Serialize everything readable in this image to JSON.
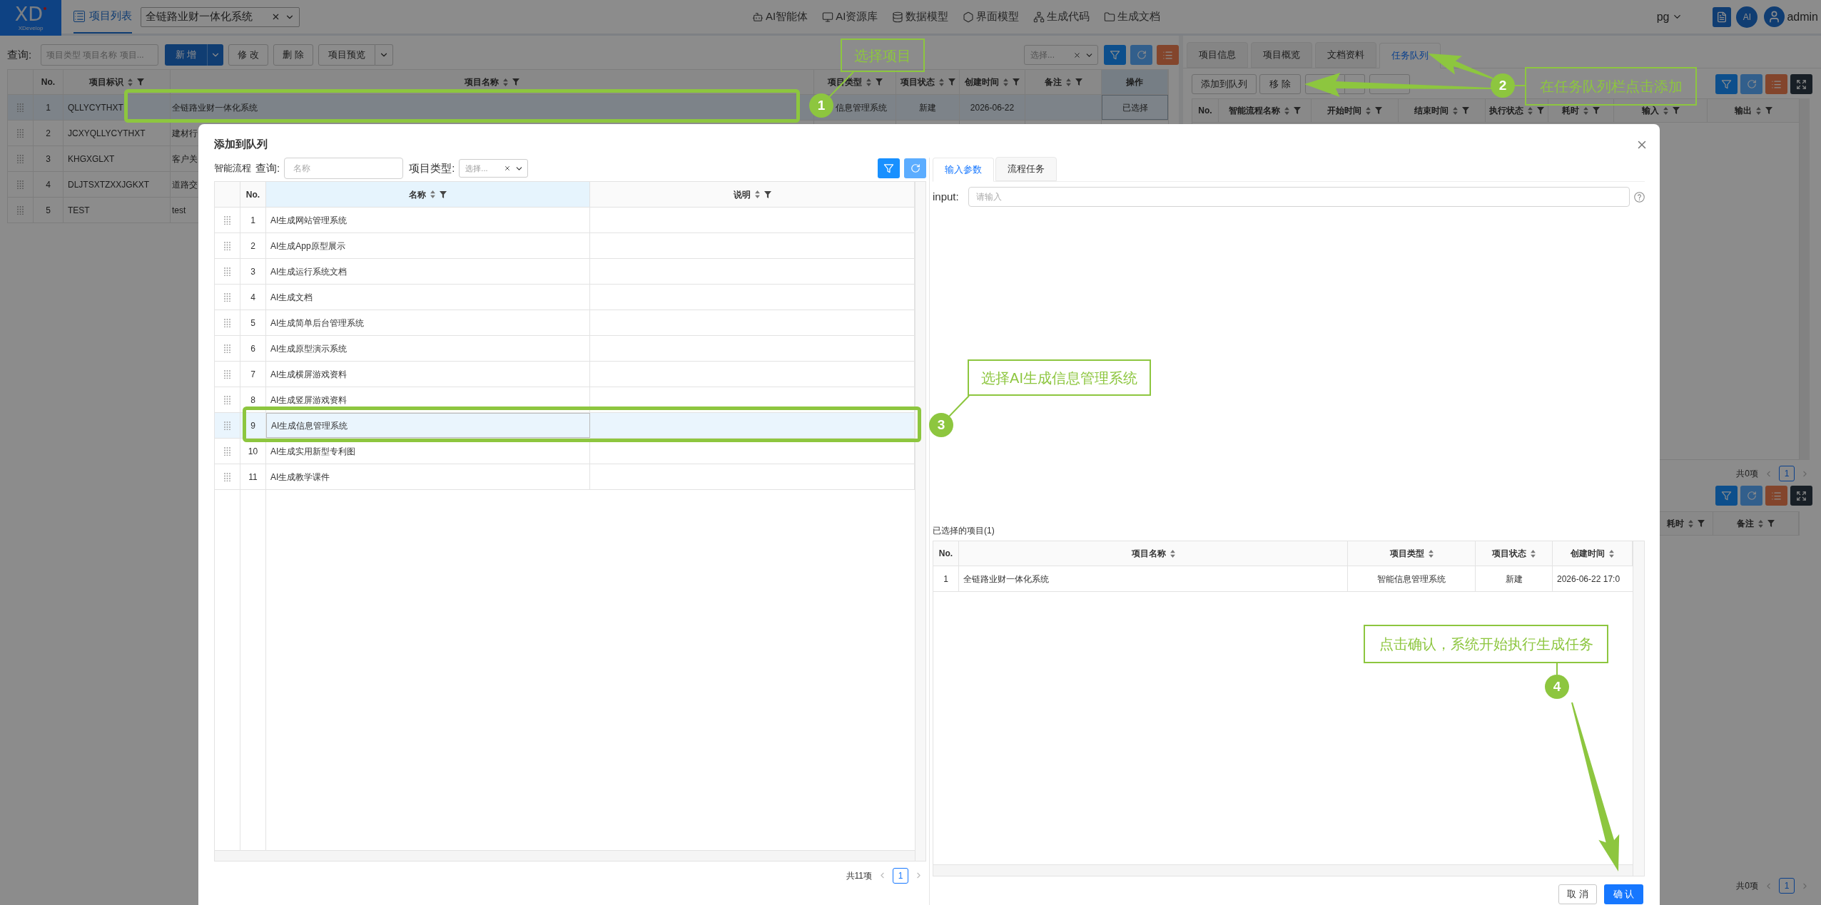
{
  "header": {
    "logo": {
      "mark": "XD",
      "name": "XDevelop"
    },
    "tabs": [
      {
        "label": "项目列表",
        "selected": true
      }
    ],
    "project_select": {
      "value": "全链路业财一体化系统"
    },
    "nav": [
      {
        "label": "AI智能体",
        "kind": "agent"
      },
      {
        "label": "AI资源库",
        "kind": "resources"
      },
      {
        "label": "数据模型",
        "kind": "data"
      },
      {
        "label": "界面模型",
        "kind": "ui"
      },
      {
        "label": "生成代码",
        "kind": "code"
      },
      {
        "label": "生成文档",
        "kind": "docs"
      }
    ],
    "database": "pg",
    "ai_button": "AI",
    "user": "admin"
  },
  "project_list": {
    "query_label": "查询:",
    "search": {
      "placeholder": "项目类型 项目名称 项目..."
    },
    "buttons": [
      {
        "label": "新 增",
        "kind": "primary-split"
      },
      {
        "label": "修 改",
        "kind": "default"
      },
      {
        "label": "删 除",
        "kind": "default"
      },
      {
        "label": "项目预览",
        "kind": "split"
      }
    ],
    "filter_select": {
      "placeholder": "选择..."
    },
    "table": {
      "columns": [
        {
          "label": "No.",
          "kind": "plain"
        },
        {
          "label": "项目标识",
          "kind": "sort-filter"
        },
        {
          "label": "项目名称",
          "kind": "sort-filter"
        },
        {
          "label": "项目类型",
          "kind": "sort-filter"
        },
        {
          "label": "项目状态",
          "kind": "sort-filter"
        },
        {
          "label": "创建时间",
          "kind": "sort-filter"
        },
        {
          "label": "备注",
          "kind": "sort-filter"
        },
        {
          "label": "操作",
          "kind": "action"
        }
      ],
      "rows": [
        {
          "no": "1",
          "code": "QLLYCYTHXT",
          "name": "全链路业财一体化系统",
          "type": "信息管理系统",
          "status": "新建",
          "created": "2026-06-22",
          "action": "已选择",
          "selected": true
        },
        {
          "no": "2",
          "code": "JCXYQLLYCYTHXT",
          "name": "建材行",
          "selected": false
        },
        {
          "no": "3",
          "code": "KHGXGLXT",
          "name": "客户关",
          "selected": false
        },
        {
          "no": "4",
          "code": "DLJTSXTZXXJGKXT",
          "name": "道路交",
          "selected": false
        },
        {
          "no": "5",
          "code": "TEST",
          "name": "test",
          "selected": false
        }
      ]
    }
  },
  "task_panel": {
    "tabs": [
      {
        "label": "项目信息",
        "selected": false
      },
      {
        "label": "项目概览",
        "selected": false
      },
      {
        "label": "文档资料",
        "selected": false
      },
      {
        "label": "任务队列",
        "selected": true
      }
    ],
    "buttons": [
      {
        "label": "添加到队列"
      },
      {
        "label": "移 除"
      }
    ],
    "table": {
      "columns": [
        {
          "label": "No.",
          "kind": "plain"
        },
        {
          "label": "智能流程名称",
          "kind": "sort-filter"
        },
        {
          "label": "开始时间",
          "kind": "sort-filter"
        },
        {
          "label": "结束时间",
          "kind": "sort-filter"
        },
        {
          "label": "执行状态",
          "kind": "sort-filter"
        },
        {
          "label": "耗时",
          "kind": "sort-filter"
        },
        {
          "label": "输入",
          "kind": "sort-filter"
        },
        {
          "label": "输出",
          "kind": "sort-filter"
        }
      ]
    },
    "pagination": {
      "total": "共0项",
      "page": "1"
    },
    "detail_table": {
      "columns": [
        {
          "label": "耗时",
          "kind": "sort-filter"
        },
        {
          "label": "备注",
          "kind": "sort-filter"
        }
      ]
    },
    "detail_pagination": {
      "total": "共0项",
      "page": "1"
    }
  },
  "dialog": {
    "title": "添加到队列",
    "flow_label": "智能流程",
    "query_label": "查询:",
    "name_search": {
      "placeholder": "名称"
    },
    "type_label": "项目类型:",
    "type_select": {
      "placeholder": "选择..."
    },
    "flow_table": {
      "columns": [
        {
          "label": "No.",
          "kind": "plain",
          "highlighted": false
        },
        {
          "label": "名称",
          "kind": "sort-filter",
          "highlighted": true
        },
        {
          "label": "说明",
          "kind": "sort-filter",
          "highlighted": false
        }
      ],
      "rows": [
        {
          "no": "1",
          "name": "AI生成网站管理系统",
          "selected": false
        },
        {
          "no": "2",
          "name": "AI生成App原型展示",
          "selected": false
        },
        {
          "no": "3",
          "name": "AI生成运行系统文档",
          "selected": false
        },
        {
          "no": "4",
          "name": "AI生成文档",
          "selected": false
        },
        {
          "no": "5",
          "name": "AI生成简单后台管理系统",
          "selected": false
        },
        {
          "no": "6",
          "name": "AI生成原型演示系统",
          "selected": false
        },
        {
          "no": "7",
          "name": "AI生成横屏游戏资料",
          "selected": false
        },
        {
          "no": "8",
          "name": "AI生成竖屏游戏资料",
          "selected": false
        },
        {
          "no": "9",
          "name": "AI生成信息管理系统",
          "selected": true
        },
        {
          "no": "10",
          "name": "AI生成实用新型专利图",
          "selected": false
        },
        {
          "no": "11",
          "name": "AI生成教学课件",
          "selected": false
        }
      ]
    },
    "flow_pagination": {
      "total": "共11项",
      "page": "1"
    },
    "tabs": [
      {
        "label": "输入参数",
        "selected": true
      },
      {
        "label": "流程任务",
        "selected": false
      }
    ],
    "input_param": {
      "label": "input:",
      "placeholder": "请输入"
    },
    "selected_title": "已选择的项目(1)",
    "selected_table": {
      "columns": [
        {
          "label": "No.",
          "kind": "plain"
        },
        {
          "label": "项目名称",
          "kind": "sort"
        },
        {
          "label": "项目类型",
          "kind": "sort"
        },
        {
          "label": "项目状态",
          "kind": "sort"
        },
        {
          "label": "创建时间",
          "kind": "sort"
        }
      ],
      "rows": [
        {
          "no": "1",
          "name": "全链路业财一体化系统",
          "type": "智能信息管理系统",
          "status": "新建",
          "created": "2026-06-22 17:0"
        }
      ]
    },
    "buttons": [
      {
        "label": "取 消",
        "kind": "default"
      },
      {
        "label": "确 认",
        "kind": "primary"
      }
    ]
  },
  "annotations": [
    {
      "number": "1",
      "text": "选择项目"
    },
    {
      "number": "2",
      "text": "在任务队列栏点击添加"
    },
    {
      "number": "3",
      "text": "选择AI生成信息管理系统"
    },
    {
      "number": "4",
      "text": "点击确认，系统开始执行生成任务"
    }
  ]
}
